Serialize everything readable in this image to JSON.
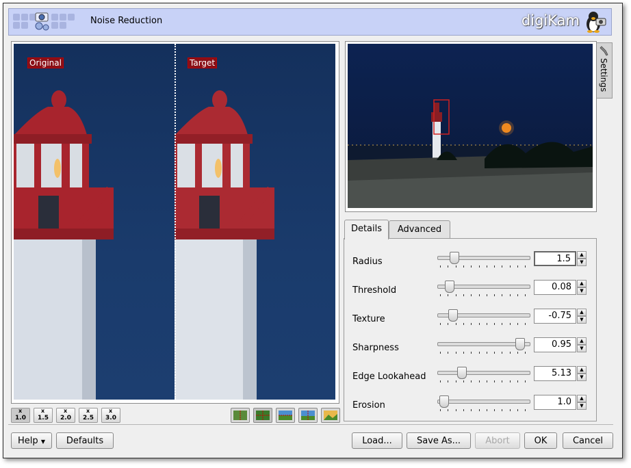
{
  "header": {
    "title": "Noise Reduction",
    "brand": "digiKam"
  },
  "preview": {
    "original_label": "Original",
    "target_label": "Target"
  },
  "zoom_buttons": [
    "1.0",
    "1.5",
    "2.0",
    "2.5",
    "3.0"
  ],
  "zoom_x": "x",
  "view_buttons": [
    "split-vertical-icon",
    "split-horizontal-icon",
    "compare-horizontal-icon",
    "compare-vertical-icon",
    "target-only-icon"
  ],
  "side_tab": {
    "label": "Settings"
  },
  "tabs": [
    {
      "label": "Details",
      "active": true
    },
    {
      "label": "Advanced",
      "active": false
    }
  ],
  "settings": [
    {
      "label": "Radius",
      "value": "1.5",
      "fraction": 0.14,
      "focused": true
    },
    {
      "label": "Threshold",
      "value": "0.08",
      "fraction": 0.08,
      "focused": false
    },
    {
      "label": "Texture",
      "value": "-0.75",
      "fraction": 0.12,
      "focused": false
    },
    {
      "label": "Sharpness",
      "value": "0.95",
      "fraction": 0.93,
      "focused": false
    },
    {
      "label": "Edge Lookahead",
      "value": "5.13",
      "fraction": 0.23,
      "focused": false
    },
    {
      "label": "Erosion",
      "value": "1.0",
      "fraction": 0.02,
      "focused": false
    }
  ],
  "buttons": {
    "help": "Help",
    "defaults": "Defaults",
    "load": "Load...",
    "save_as": "Save As...",
    "abort": "Abort",
    "ok": "OK",
    "cancel": "Cancel"
  },
  "colors": {
    "header_bg": "#c8d2f7",
    "lighthouse_red": "#a8242d",
    "sky": "#1a3b6c",
    "selection_box": "#d02020"
  }
}
